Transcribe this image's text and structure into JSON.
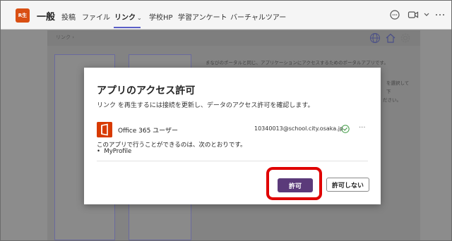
{
  "header": {
    "team_badge": "R生",
    "channel_title": "一般",
    "tabs": [
      {
        "label": "投稿"
      },
      {
        "label": "ファイル"
      },
      {
        "label": "リンク",
        "active": true
      },
      {
        "label": "学校HP"
      },
      {
        "label": "学習アンケート"
      },
      {
        "label": "バーチャルツアー"
      }
    ]
  },
  "tab_view": {
    "breadcrumb": "リンク",
    "background_text": [
      "まなびのポータルと同じ、アプリケーションにアクセスするためのポータルアプリです。",
      "を選択して",
      "下",
      "ださい。"
    ]
  },
  "dialog": {
    "title": "アプリのアクセス許可",
    "description": "リンク を再生するには接続を更新し、データのアクセス許可を確認します。",
    "app_name": "Office 365 ユーザー",
    "user_email": "10340013@school.city.osaka.jp",
    "permission_intro": "このアプリで行うことができるのは、次のとおりです。",
    "permissions": [
      "MyProfile"
    ],
    "allow_label": "許可",
    "deny_label": "許可しない"
  },
  "colors": {
    "accent": "#5b5fc7",
    "allow_button": "#5b3a7a",
    "highlight": "#e00000",
    "office_orange": "#d83b01"
  }
}
